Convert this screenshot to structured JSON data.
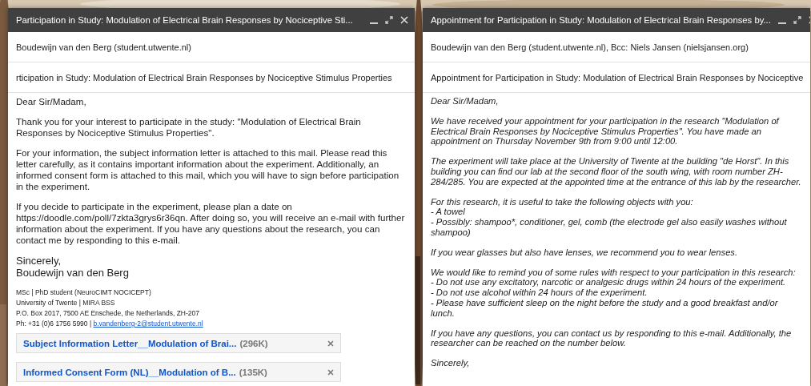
{
  "windows": [
    {
      "title": "Participation in Study: Modulation of Electrical Brain Responses by Nociceptive Sti...",
      "recipients": "Boudewijn van den Berg (student.utwente.nl)",
      "subject": "rticipation in Study: Modulation of Electrical Brain Responses by Nociceptive Stimulus Properties",
      "italic": false,
      "paragraphs": [
        [
          "Dear Sir/Madam,"
        ],
        [
          "Thank you for your interest to participate in the study: \"Modulation of Electrical Brain Responses by Nociceptive Stimulus Properties\"."
        ],
        [
          "For your information, the subject information letter is attached to this mail. Please read this letter carefully, as it contains important information about the experiment. Additionally, an informed consent form is attached to this mail, which you will have to sign before participation in the experiment."
        ],
        [
          "If you decide to participate in the experiment, please plan a date on https://doodle.com/poll/7zkta3grys6r36qn. After doing so, you will receive an e-mail with further information about the experiment. If you have any questions about the research, you can contact me by responding to this e-mail."
        ],
        [
          "Sincerely,",
          "Boudewijn van den Berg"
        ]
      ],
      "signature": [
        {
          "text": "MSc | PhD student (NeuroCIMT NOCICEPT)"
        },
        {
          "text": "University of Twente | MIRA BSS"
        },
        {
          "text": "P.O. Box 2017, 7500 AE Enschede, the Netherlands, ZH-207"
        },
        {
          "text": "Ph: +31 (0)6 1756 5990 | ",
          "link": "b.vandenberg-2@student.utwente.nl"
        }
      ],
      "attachments": [
        {
          "name": "Subject Information Letter__Modulation of Brai...",
          "size": "(296K)"
        },
        {
          "name": "Informed Consent Form (NL)__Modulation of B...",
          "size": "(135K)"
        }
      ]
    },
    {
      "title": "Appointment for Participation in Study: Modulation of Electrical Brain Responses by...",
      "recipients": "Boudewijn van den Berg (student.utwente.nl), Bcc: Niels Jansen (nielsjansen.org)",
      "subject": "Appointment for Participation in Study: Modulation of Electrical Brain Responses by Nociceptive",
      "italic": true,
      "paragraphs": [
        [
          "Dear Sir/Madam,"
        ],
        [
          "We have received your appointment for your participation in the research \"Modulation of Electrical Brain Responses by Nociceptive Stimulus Properties\". You have made an appointment on Thursday November 9th from 9:00 until 12:00."
        ],
        [
          "The experiment will take place at the University of Twente at the building \"de Horst\". In this building you can find our lab at the second floor of the south wing, with room number ZH-284/285. You are expected at the appointed time at the entrance of this lab by the researcher."
        ],
        [
          "For this research, it is useful to take the following objects with you:",
          "- A towel",
          "- Possibly: shampoo*, conditioner, gel, comb (the electrode gel also easily washes without shampoo)"
        ],
        [
          "If you wear glasses but also have lenses, we recommend you to wear lenses."
        ],
        [
          "We would like to remind you of some rules with respect to your participation in this research:",
          "- Do not use any excitatory, narcotic or analgesic drugs within 24 hours of the experiment.",
          "- Do not use alcohol within 24 hours of the experiment.",
          "- Please have sufficient sleep on the night before the study and a good breakfast and/or lunch."
        ],
        [
          "If you have any questions, you can contact us by responding to this e-mail. Additionally, the researcher can be reached on the number below."
        ],
        [
          "Sincerely,"
        ]
      ]
    }
  ]
}
